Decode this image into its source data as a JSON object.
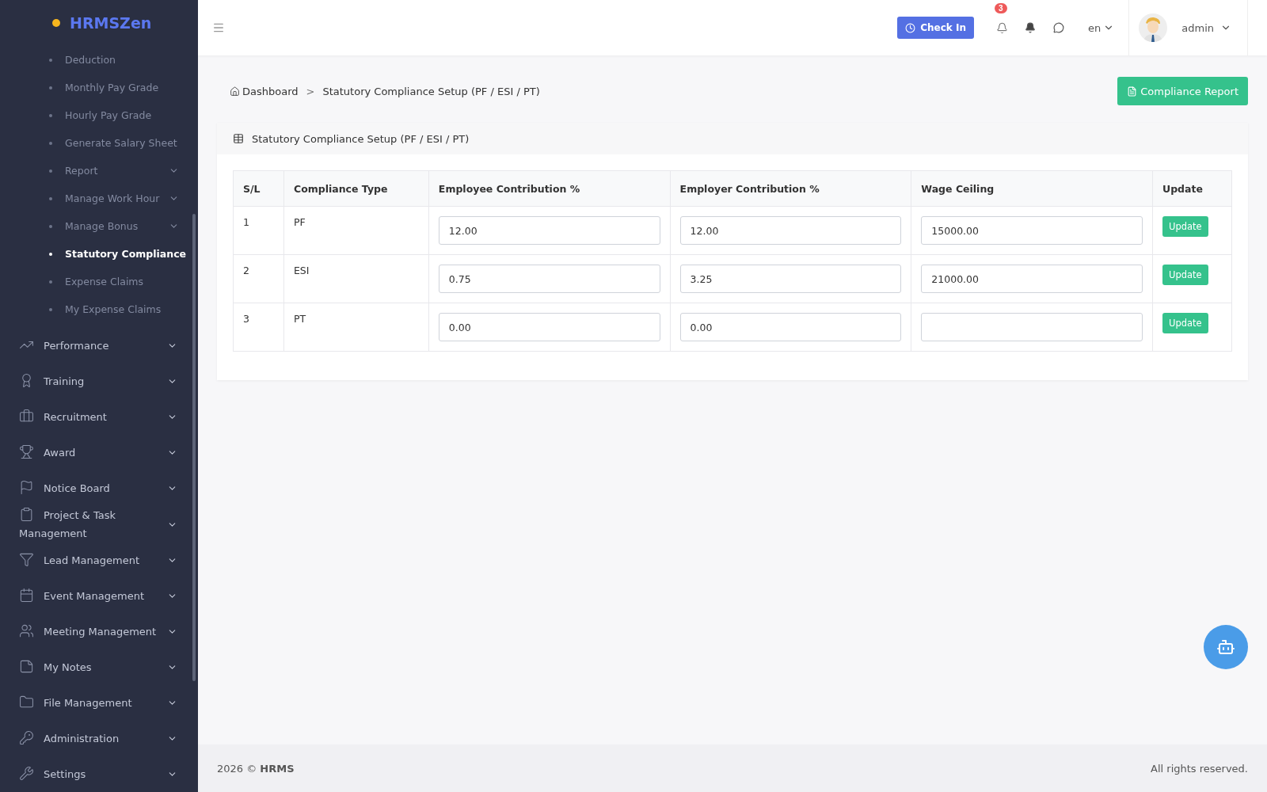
{
  "brand": {
    "name": "HRMSZen"
  },
  "sidebar": {
    "sub_items": [
      {
        "label": "Deduction",
        "selected": false,
        "has_caret": false
      },
      {
        "label": "Monthly Pay Grade",
        "selected": false,
        "has_caret": false
      },
      {
        "label": "Hourly Pay Grade",
        "selected": false,
        "has_caret": false
      },
      {
        "label": "Generate Salary Sheet",
        "selected": false,
        "has_caret": false
      },
      {
        "label": "Report",
        "selected": false,
        "has_caret": true
      },
      {
        "label": "Manage Work Hour",
        "selected": false,
        "has_caret": true
      },
      {
        "label": "Manage Bonus",
        "selected": false,
        "has_caret": true
      },
      {
        "label": "Statutory Compliance",
        "selected": true,
        "has_caret": false
      },
      {
        "label": "Expense Claims",
        "selected": false,
        "has_caret": false
      },
      {
        "label": "My Expense Claims",
        "selected": false,
        "has_caret": false
      }
    ],
    "items": [
      {
        "label": "Performance"
      },
      {
        "label": "Training"
      },
      {
        "label": "Recruitment"
      },
      {
        "label": "Award"
      },
      {
        "label": "Notice Board"
      },
      {
        "label": "Project & Task Management"
      },
      {
        "label": "Lead Management"
      },
      {
        "label": "Event Management"
      },
      {
        "label": "Meeting Management"
      },
      {
        "label": "My Notes"
      },
      {
        "label": "File Management"
      },
      {
        "label": "Administration"
      },
      {
        "label": "Settings"
      }
    ]
  },
  "header": {
    "check_in": "Check In",
    "notification_count": "3",
    "language": "en",
    "user": "admin"
  },
  "breadcrumb": [
    "Dashboard",
    ">",
    "Statutory Compliance Setup (PF / ESI / PT)"
  ],
  "report_button": "Compliance Report",
  "card": {
    "title": "Statutory Compliance Setup (PF / ESI / PT)",
    "columns": [
      "S/L",
      "Compliance Type",
      "Employee Contribution %",
      "Employer Contribution %",
      "Wage Ceiling",
      "Update"
    ],
    "rows": [
      {
        "sl": "1",
        "type": "PF",
        "employee": "12.00",
        "employer": "12.00",
        "wage_ceiling": "15000.00",
        "action": "Update"
      },
      {
        "sl": "2",
        "type": "ESI",
        "employee": "0.75",
        "employer": "3.25",
        "wage_ceiling": "21000.00",
        "action": "Update"
      },
      {
        "sl": "3",
        "type": "PT",
        "employee": "0.00",
        "employer": "0.00",
        "action": "Update"
      }
    ]
  },
  "footer": {
    "year": "2026 ©",
    "brand": "HRMS",
    "rights": "All rights reserved."
  }
}
